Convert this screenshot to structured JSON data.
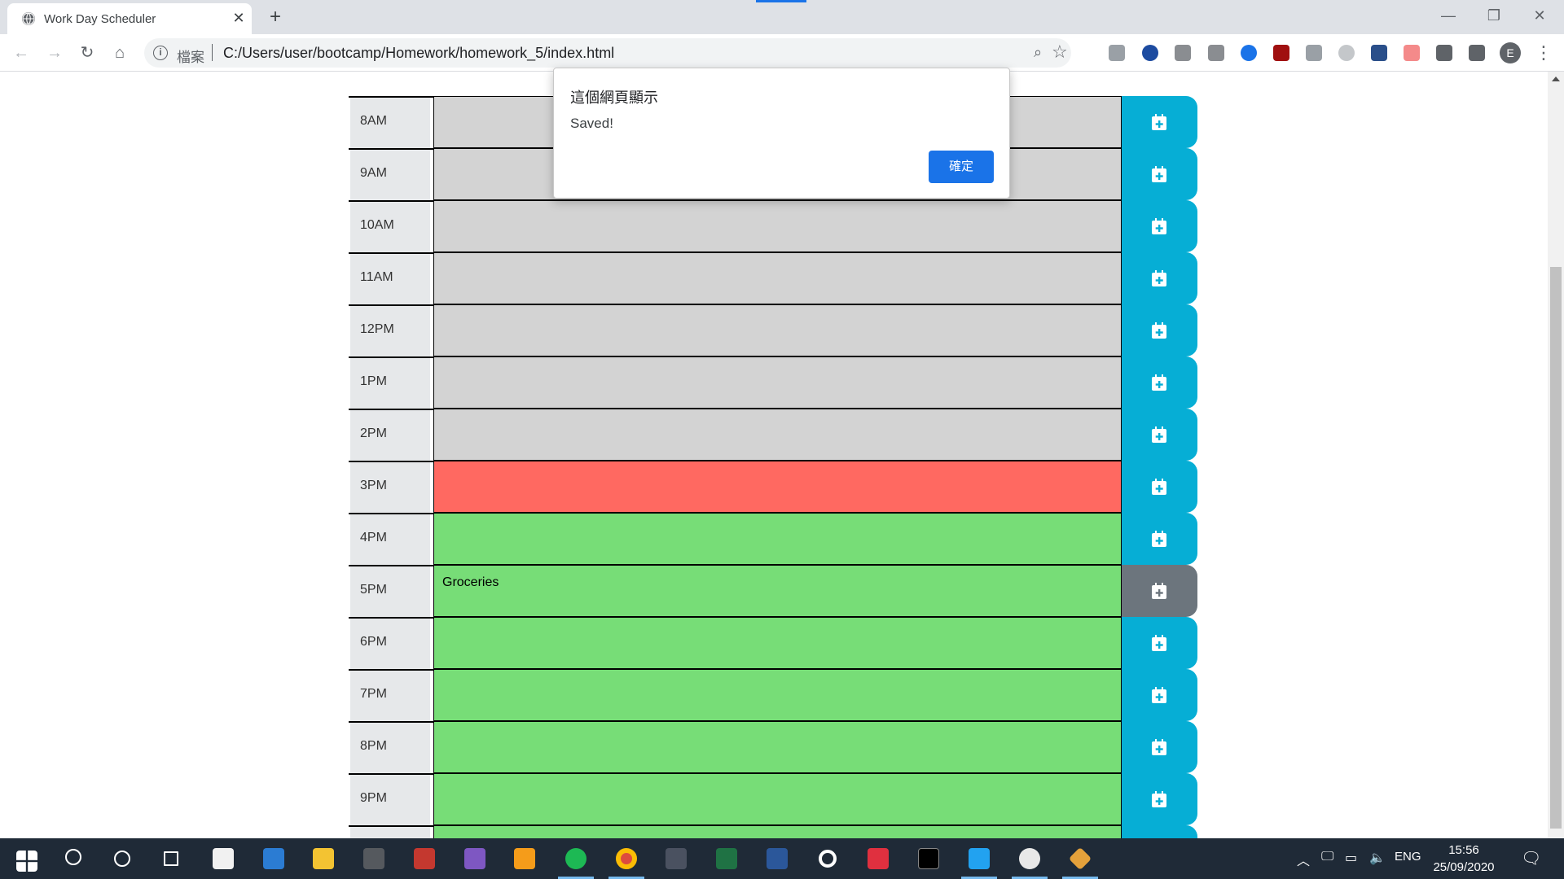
{
  "browser": {
    "tab_title": "Work Day Scheduler",
    "tab_close": "✕",
    "new_tab": "+",
    "window_controls": [
      "—",
      "❐",
      "✕"
    ],
    "nav": {
      "back": "←",
      "forward": "→",
      "reload": "↻",
      "home": "⌂"
    },
    "omnibox": {
      "scheme_label": "檔案",
      "url": "C:/Users/user/bootcamp/Homework/homework_5/index.html"
    },
    "profile_initial": "E",
    "menu": "⋮"
  },
  "alert": {
    "heading": "這個網頁顯示",
    "message": "Saved!",
    "ok_label": "確定"
  },
  "schedule": {
    "rows": [
      {
        "hour": "8AM",
        "status": "past",
        "text": ""
      },
      {
        "hour": "9AM",
        "status": "past",
        "text": ""
      },
      {
        "hour": "10AM",
        "status": "past",
        "text": ""
      },
      {
        "hour": "11AM",
        "status": "past",
        "text": ""
      },
      {
        "hour": "12PM",
        "status": "past",
        "text": ""
      },
      {
        "hour": "1PM",
        "status": "past",
        "text": ""
      },
      {
        "hour": "2PM",
        "status": "past",
        "text": ""
      },
      {
        "hour": "3PM",
        "status": "present",
        "text": ""
      },
      {
        "hour": "4PM",
        "status": "future",
        "text": ""
      },
      {
        "hour": "5PM",
        "status": "future",
        "text": "Groceries"
      },
      {
        "hour": "6PM",
        "status": "future",
        "text": ""
      },
      {
        "hour": "7PM",
        "status": "future",
        "text": ""
      },
      {
        "hour": "8PM",
        "status": "future",
        "text": ""
      },
      {
        "hour": "9PM",
        "status": "future",
        "text": ""
      },
      {
        "hour": "",
        "status": "future",
        "text": ""
      }
    ],
    "hovered_row": 9
  },
  "taskbar": {
    "tray_language": "ENG",
    "time": "15:56",
    "date": "25/09/2020"
  },
  "colors": {
    "past": "#d3d3d3",
    "present": "#ff6961",
    "future": "#77dd77",
    "save_button": "#06aed5",
    "save_button_hover": "#6c757d",
    "dialog_ok": "#1a73e8"
  }
}
